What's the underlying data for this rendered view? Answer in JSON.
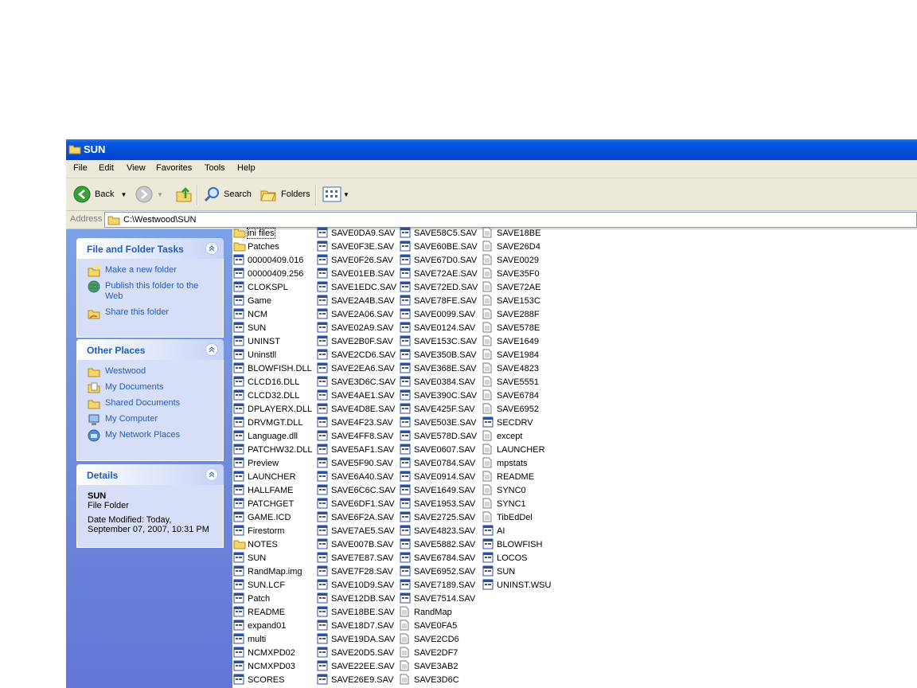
{
  "window": {
    "title": "SUN"
  },
  "menu": [
    "File",
    "Edit",
    "View",
    "Favorites",
    "Tools",
    "Help"
  ],
  "toolbar": {
    "back": "Back",
    "search": "Search",
    "folders": "Folders"
  },
  "address": {
    "label": "Address",
    "path": "C:\\Westwood\\SUN"
  },
  "tasks": {
    "title": "File and Folder Tasks",
    "items": [
      "Make a new folder",
      "Publish this folder to the Web",
      "Share this folder"
    ]
  },
  "places": {
    "title": "Other Places",
    "items": [
      "Westwood",
      "My Documents",
      "Shared Documents",
      "My Computer",
      "My Network Places"
    ]
  },
  "details": {
    "title": "Details",
    "name": "SUN",
    "type": "File Folder",
    "modified": "Date Modified: Today, September 07, 2007, 10:31 PM"
  },
  "columns": [
    [
      "ini files",
      "Patches",
      "00000409.016",
      "00000409.256",
      "CLOKSPL",
      "Game",
      "NCM",
      "SUN",
      "UNINST",
      "Uninstll",
      "BLOWFISH.DLL",
      "CLCD16.DLL",
      "CLCD32.DLL",
      "DPLAYERX.DLL",
      "DRVMGT.DLL",
      "Language.dll",
      "PATCHW32.DLL",
      "Preview",
      "LAUNCHER",
      "HALLFAME",
      "PATCHGET",
      "GAME.ICD",
      "Firestorm",
      "NOTES",
      "SUN",
      "RandMap.img",
      "SUN.LCF",
      "Patch",
      "README",
      "expand01",
      "multi",
      "NCMXPD02",
      "NCMXPD03",
      "SCORES"
    ],
    [
      "SAVE0DA9.SAV",
      "SAVE0F3E.SAV",
      "SAVE0F26.SAV",
      "SAVE01EB.SAV",
      "SAVE1EDC.SAV",
      "SAVE2A4B.SAV",
      "SAVE2A06.SAV",
      "SAVE02A9.SAV",
      "SAVE2B0F.SAV",
      "SAVE2CD6.SAV",
      "SAVE2EA6.SAV",
      "SAVE3D6C.SAV",
      "SAVE4AE1.SAV",
      "SAVE4D8E.SAV",
      "SAVE4F23.SAV",
      "SAVE4FF8.SAV",
      "SAVE5AF1.SAV",
      "SAVE5F90.SAV",
      "SAVE6A40.SAV",
      "SAVE6C6C.SAV",
      "SAVE6DF1.SAV",
      "SAVE6F2A.SAV",
      "SAVE7AE5.SAV",
      "SAVE007B.SAV",
      "SAVE7E87.SAV",
      "SAVE7F28.SAV",
      "SAVE10D9.SAV",
      "SAVE12DB.SAV",
      "SAVE18BE.SAV",
      "SAVE18D7.SAV",
      "SAVE19DA.SAV",
      "SAVE20D5.SAV",
      "SAVE22EE.SAV",
      "SAVE26E9.SAV"
    ],
    [
      "SAVE58C5.SAV",
      "SAVE60BE.SAV",
      "SAVE67D0.SAV",
      "SAVE72AE.SAV",
      "SAVE72ED.SAV",
      "SAVE78FE.SAV",
      "SAVE0099.SAV",
      "SAVE0124.SAV",
      "SAVE153C.SAV",
      "SAVE350B.SAV",
      "SAVE368E.SAV",
      "SAVE0384.SAV",
      "SAVE390C.SAV",
      "SAVE425F.SAV",
      "SAVE503E.SAV",
      "SAVE578D.SAV",
      "SAVE0607.SAV",
      "SAVE0784.SAV",
      "SAVE0914.SAV",
      "SAVE1649.SAV",
      "SAVE1953.SAV",
      "SAVE2725.SAV",
      "SAVE4823.SAV",
      "SAVE5882.SAV",
      "SAVE6784.SAV",
      "SAVE6952.SAV",
      "SAVE7189.SAV",
      "SAVE7514.SAV",
      "RandMap",
      "SAVE0FA5",
      "SAVE2CD6",
      "SAVE2DF7",
      "SAVE3AB2",
      "SAVE3D6C"
    ],
    [
      "SAVE18BE",
      "SAVE26D4",
      "SAVE0029",
      "SAVE35F0",
      "SAVE72AE",
      "SAVE153C",
      "SAVE288F",
      "SAVE578E",
      "SAVE1649",
      "SAVE1984",
      "SAVE4823",
      "SAVE5551",
      "SAVE6784",
      "SAVE6952",
      "SECDRV",
      "except",
      "LAUNCHER",
      "mpstats",
      "README",
      "SYNC0",
      "SYNC1",
      "TibEdDel",
      "AI",
      "BLOWFISH",
      "LOCOS",
      "SUN",
      "UNINST.WSU"
    ]
  ],
  "colors": {
    "titlebar": "#0450d8",
    "sidebar": "#6f8fe0",
    "link": "#215dc6"
  }
}
